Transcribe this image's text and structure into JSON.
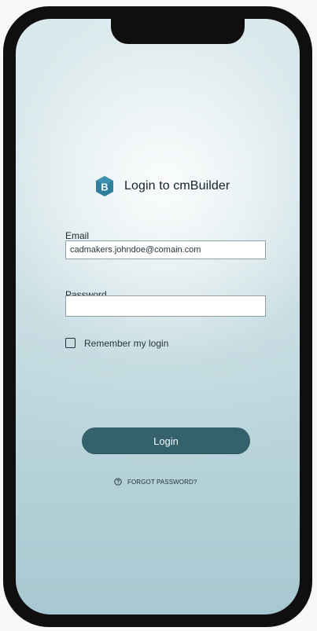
{
  "app": {
    "title": "Login to cmBuilder"
  },
  "brand": {
    "logo_icon": "cmbuilder-logo-icon",
    "logo_letter": "B",
    "logo_color": "#2f7e9b"
  },
  "form": {
    "email_label": "Email",
    "email_value": "cadmakers.johndoe@comain.com",
    "password_label": "Password",
    "password_value": "",
    "remember_label": "Remember my login",
    "login_label": "Login",
    "forgot_label": "FORGOT PASSWORD?"
  },
  "icons": {
    "checkbox": "checkbox-icon",
    "help": "help-circle-icon"
  },
  "colors": {
    "accent": "#35616d",
    "background_top": "#dce9ec",
    "background_bottom": "#a8c8d1",
    "device_frame": "#0f0f0f"
  }
}
